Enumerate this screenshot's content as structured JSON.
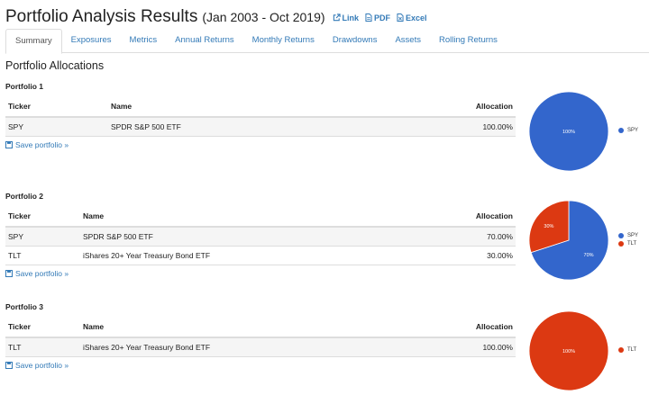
{
  "header": {
    "title": "Portfolio Analysis Results",
    "range": "(Jan 2003 - Oct 2019)",
    "links": [
      {
        "label": "Link",
        "icon": "external-link-icon"
      },
      {
        "label": "PDF",
        "icon": "pdf-file-icon"
      },
      {
        "label": "Excel",
        "icon": "excel-file-icon"
      }
    ]
  },
  "tabs": [
    "Summary",
    "Exposures",
    "Metrics",
    "Annual Returns",
    "Monthly Returns",
    "Drawdowns",
    "Assets",
    "Rolling Returns"
  ],
  "active_tab": "Summary",
  "section_title": "Portfolio Allocations",
  "columns": {
    "ticker": "Ticker",
    "name": "Name",
    "allocation": "Allocation"
  },
  "save_label": "Save portfolio »",
  "colors": {
    "SPY": "#3366cc",
    "TLT": "#dc3912",
    "link": "#337ab7"
  },
  "portfolios": [
    {
      "title": "Portfolio 1",
      "rows": [
        {
          "ticker": "SPY",
          "name": "SPDR S&P 500 ETF",
          "allocation": "100.00%"
        }
      ],
      "pie": {
        "slices": [
          {
            "ticker": "SPY",
            "value": 100,
            "label": "100%"
          }
        ],
        "legend": [
          "SPY"
        ]
      }
    },
    {
      "title": "Portfolio 2",
      "rows": [
        {
          "ticker": "SPY",
          "name": "SPDR S&P 500 ETF",
          "allocation": "70.00%"
        },
        {
          "ticker": "TLT",
          "name": "iShares 20+ Year Treasury Bond ETF",
          "allocation": "30.00%"
        }
      ],
      "pie": {
        "slices": [
          {
            "ticker": "SPY",
            "value": 70,
            "label": "70%"
          },
          {
            "ticker": "TLT",
            "value": 30,
            "label": "30%"
          }
        ],
        "legend": [
          "SPY",
          "TLT"
        ]
      }
    },
    {
      "title": "Portfolio 3",
      "rows": [
        {
          "ticker": "TLT",
          "name": "iShares 20+ Year Treasury Bond ETF",
          "allocation": "100.00%"
        }
      ],
      "pie": {
        "slices": [
          {
            "ticker": "TLT",
            "value": 100,
            "label": "100%"
          }
        ],
        "legend": [
          "TLT"
        ]
      }
    }
  ]
}
